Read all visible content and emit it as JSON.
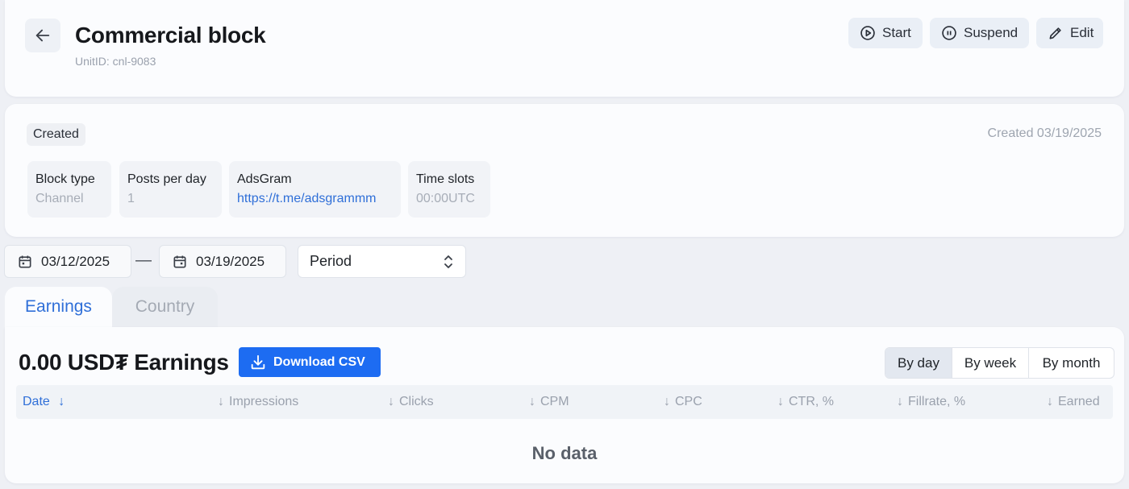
{
  "header": {
    "title": "Commercial block",
    "unit_id": "UnitID: cnl-9083",
    "actions": {
      "start": "Start",
      "suspend": "Suspend",
      "edit": "Edit"
    }
  },
  "info": {
    "status": "Created",
    "created_date": "Created 03/19/2025",
    "fields": [
      {
        "label": "Block type",
        "value": "Channel"
      },
      {
        "label": "Posts per day",
        "value": "1"
      },
      {
        "label": "AdsGram",
        "value": "https://t.me/adsgrammm"
      },
      {
        "label": "Time slots",
        "value": "00:00UTC"
      }
    ]
  },
  "filters": {
    "date_from": "03/12/2025",
    "separator": "—",
    "date_to": "03/19/2025",
    "period": "Period"
  },
  "tabs": [
    {
      "label": "Earnings",
      "active": true
    },
    {
      "label": "Country",
      "active": false
    }
  ],
  "earnings": {
    "title": "0.00 USD₮ Earnings",
    "download_label": "Download CSV",
    "granularity": [
      "By day",
      "By week",
      "By month"
    ],
    "selected_granularity": "By day"
  },
  "table": {
    "columns": [
      "Date",
      "Impressions",
      "Clicks",
      "CPM",
      "CPC",
      "CTR, %",
      "Fillrate, %",
      "Earned"
    ],
    "empty_text": "No data"
  },
  "colors": {
    "accent": "#1d6cf2",
    "link": "#2f6fd8",
    "background": "#eef0f5",
    "card": "#fbfcfe"
  }
}
